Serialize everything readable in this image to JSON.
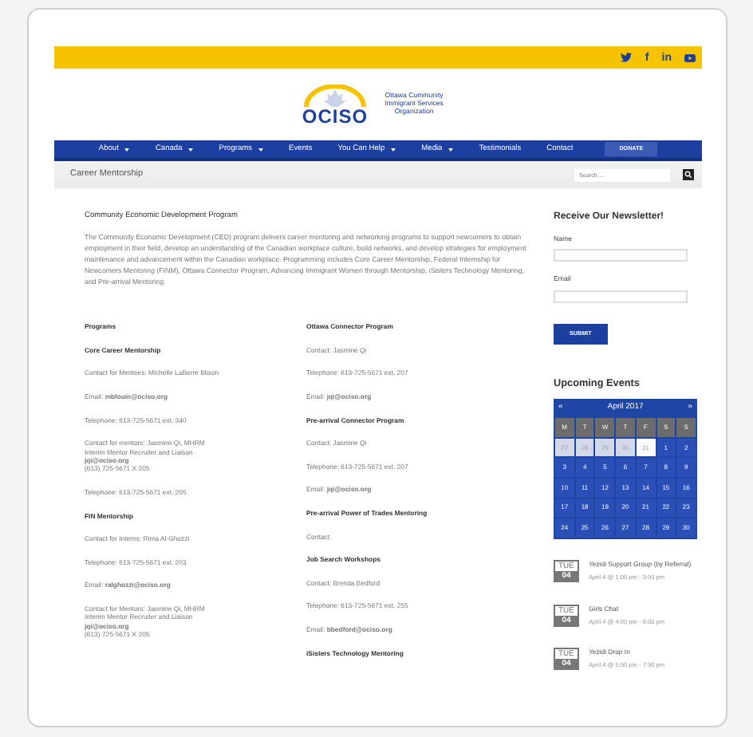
{
  "social": [
    {
      "kind": "twitter"
    },
    {
      "kind": "text",
      "label": "f"
    },
    {
      "kind": "text",
      "label": "in"
    },
    {
      "kind": "youtube"
    }
  ],
  "logo": {
    "wordmark": "OCISO",
    "name": "Ottawa Community Immigrant Services Organization"
  },
  "nav": [
    {
      "label": "About",
      "dropdown": true
    },
    {
      "label": "Canada",
      "dropdown": true
    },
    {
      "label": "Programs",
      "dropdown": true
    },
    {
      "label": "Events",
      "dropdown": false
    },
    {
      "label": "You Can Help",
      "dropdown": true
    },
    {
      "label": "Media",
      "dropdown": true
    },
    {
      "label": "Testimonials",
      "dropdown": false
    },
    {
      "label": "Contact",
      "dropdown": false
    }
  ],
  "donate": "DONATE",
  "page_title": "Career Mentorship",
  "search": {
    "placeholder": "Search ..."
  },
  "heading": "Community Economic Development Program",
  "intro": "The Community Economic Development (CED) program delivers career mentoring and networking programs to support newcomers to obtain employment in their field, develop an understanding of the Canadian workplace culture, build networks, and develop strategies for employment maintenance and advancement within the Canadian workplace. Programming includes Core Career Mentorship, Federal Internship for Newcomers Mentoring (FINM), Ottawa Connector Program, Advancing Immigrant Women through Mentorship, iSisters Technology Mentoring, and Pre-arrival Mentoring.",
  "columns": [
    [
      {
        "kind": "title",
        "text": "Programs"
      },
      {
        "kind": "title",
        "text": "Core Career Mentorship"
      },
      {
        "kind": "text",
        "text": "Contact for Mentees: Michelle LaBerre Blouin"
      },
      {
        "kind": "text",
        "text": "Email: **mblouin@ociso.org**"
      },
      {
        "kind": "text",
        "text": "Telephone: 613-725-5671 ext. 340"
      },
      {
        "kind": "lines",
        "lines": [
          "Contact for mentors: Jasmine Qi, MHRM",
          "Interim Mentor Recruiter and Liaison",
          "**jqi@ociso.org**",
          "(613) 725-5671 X 205"
        ]
      },
      {
        "kind": "text",
        "text": "Telephone: 613-725-5671 ext. 205"
      },
      {
        "kind": "title",
        "text": "FIN Mentorship"
      },
      {
        "kind": "text",
        "text": "Contact for Interns: Rima Al-Ghozzi"
      },
      {
        "kind": "text",
        "text": "Telephone: 613-725-5671 ext. 203"
      },
      {
        "kind": "text",
        "text": "Email: **ralghozzi@ociso.org**"
      },
      {
        "kind": "lines",
        "lines": [
          "Contact for Mentors: Jasmine Qi, MHRM",
          "Interim Mentor Recruiter and Liaison",
          "**jqi@ociso.org**",
          "(613) 725-5671 X 205"
        ]
      }
    ],
    [
      {
        "kind": "title",
        "text": "Ottawa Connector Program"
      },
      {
        "kind": "text",
        "text": "Contact: Jasmine Qi"
      },
      {
        "kind": "text",
        "text": "Telephone: 613-725-5671 ext. 207"
      },
      {
        "kind": "text",
        "text": "Email: **jqi@ociso.org**"
      },
      {
        "kind": "title",
        "text": "Pre-arrival Connector Program"
      },
      {
        "kind": "text",
        "text": "Contact: Jasmine Qi"
      },
      {
        "kind": "text",
        "text": "Telephone: 613-725-5671 ext. 207"
      },
      {
        "kind": "text",
        "text": "Email: **jqi@ociso.org**"
      },
      {
        "kind": "title",
        "text": "Pre-arrival Power of Trades Mentoring"
      },
      {
        "kind": "text",
        "text": "Contact:"
      },
      {
        "kind": "title",
        "text": "Job Search Workshops"
      },
      {
        "kind": "text",
        "text": "Contact: Brenda Bedford"
      },
      {
        "kind": "text",
        "text": "Telephone: 613-725-5671 ext. 255"
      },
      {
        "kind": "text",
        "text": "Email: **bbedford@ociso.org**"
      },
      {
        "kind": "title",
        "text": "iSisters Technology Mentoring"
      }
    ]
  ],
  "newsletter": {
    "title": "Receive Our Newsletter!",
    "fields": [
      "Name",
      "Email"
    ],
    "submit": "SUBMIT"
  },
  "events_title": "Upcoming Events",
  "calendar": {
    "prev": "«",
    "month": "April 2017",
    "next": "»",
    "weekdays": [
      "M",
      "T",
      "W",
      "T",
      "F",
      "S",
      "S"
    ],
    "days": [
      {
        "label": "27",
        "muted": true,
        "today": false
      },
      {
        "label": "28",
        "muted": true,
        "today": false
      },
      {
        "label": "29",
        "muted": true,
        "today": false
      },
      {
        "label": "30",
        "muted": true,
        "today": false
      },
      {
        "label": "31",
        "muted": true,
        "today": true
      },
      {
        "label": "1",
        "muted": false,
        "today": false
      },
      {
        "label": "2",
        "muted": false,
        "today": false
      },
      {
        "label": "3",
        "muted": false,
        "today": false
      },
      {
        "label": "4",
        "muted": false,
        "today": false
      },
      {
        "label": "5",
        "muted": false,
        "today": false
      },
      {
        "label": "6",
        "muted": false,
        "today": false
      },
      {
        "label": "7",
        "muted": false,
        "today": false
      },
      {
        "label": "8",
        "muted": false,
        "today": false
      },
      {
        "label": "9",
        "muted": false,
        "today": false
      },
      {
        "label": "10",
        "muted": false,
        "today": false
      },
      {
        "label": "11",
        "muted": false,
        "today": false
      },
      {
        "label": "12",
        "muted": false,
        "today": false
      },
      {
        "label": "13",
        "muted": false,
        "today": false
      },
      {
        "label": "14",
        "muted": false,
        "today": false
      },
      {
        "label": "15",
        "muted": false,
        "today": false
      },
      {
        "label": "16",
        "muted": false,
        "today": false
      },
      {
        "label": "17",
        "muted": false,
        "today": false
      },
      {
        "label": "18",
        "muted": false,
        "today": false
      },
      {
        "label": "19",
        "muted": false,
        "today": false
      },
      {
        "label": "20",
        "muted": false,
        "today": false
      },
      {
        "label": "21",
        "muted": false,
        "today": false
      },
      {
        "label": "22",
        "muted": false,
        "today": false
      },
      {
        "label": "23",
        "muted": false,
        "today": false
      },
      {
        "label": "24",
        "muted": false,
        "today": false
      },
      {
        "label": "25",
        "muted": false,
        "today": false
      },
      {
        "label": "26",
        "muted": false,
        "today": false
      },
      {
        "label": "27",
        "muted": false,
        "today": false
      },
      {
        "label": "28",
        "muted": false,
        "today": false
      },
      {
        "label": "29",
        "muted": false,
        "today": false
      },
      {
        "label": "30",
        "muted": false,
        "today": false
      }
    ]
  },
  "events": [
    {
      "weekday": "TUE",
      "day": "04",
      "title": "Yezidi Support Group (by Referral)",
      "time": "April 4 @ 1:00 pm - 3:00 pm"
    },
    {
      "weekday": "TUE",
      "day": "04",
      "title": "Girls Chat",
      "time": "April 4 @ 4:00 pm - 6:00 pm"
    },
    {
      "weekday": "TUE",
      "day": "04",
      "title": "Yezidi Drop In",
      "time": "April 4 @ 5:00 pm - 7:30 pm"
    }
  ]
}
